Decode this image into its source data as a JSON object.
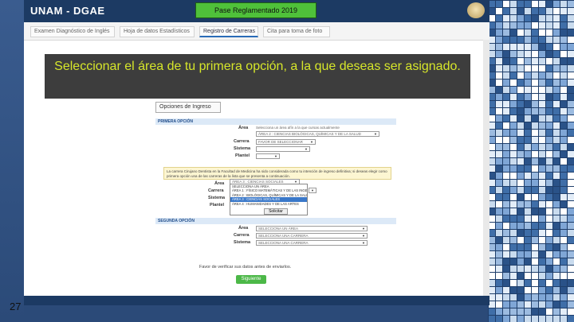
{
  "slide": {
    "title": "Seleccionar el área de tu primera opción, a la que deseas ser asignado.",
    "number": "27"
  },
  "app": {
    "title": "UNAM - DGAE",
    "badge": "Pase Reglamentado 2019",
    "tabs": [
      {
        "label": "Examen Diagnóstico de Inglés"
      },
      {
        "label": "Hoja de datos Estadísticos"
      },
      {
        "label": "Registro de Carreras"
      },
      {
        "label": "Cita para toma de foto"
      }
    ]
  },
  "form": {
    "heading": "Opciones de Ingreso",
    "first_section": "PRIMERA OPCIÓN",
    "second_section": "SEGUNDA OPCIÓN",
    "labels": {
      "area": "Área",
      "carrera": "Carrera",
      "sistema": "Sistema",
      "plantel": "Plantel"
    },
    "first": {
      "area_note": "Selecciona un área afín a la que cursas actualmente",
      "area_value": "ÁREA 2 : CIENCIAS BIOLÓGICAS, QUÍMICAS Y DE LA SALUD",
      "carrera_value": "FAVOR DE SELECCIONAR",
      "sistema_value": "",
      "plantel_value": "",
      "area2_value": "ÁREA 3 : CIENCIAS SOCIALES"
    },
    "note": "La carrera Cirujano Dentista en la Facultad de Medicina ha sido considerada como tu intención de ingreso definitiva; si deseas elegir como primera opción una de las carreras de la lista que se presenta a continuación.",
    "dropdown_options": [
      "SELECCIONA UN ÁREA",
      "ÁREA 1 : FÍSICO MATEMÁTICAS Y DE LAS INGENIERÍAS",
      "ÁREA 2 : BIOLÓGICAS, QUÍMICAS Y DE LA SALUD",
      "ÁREA 3 : CIENCIAS SOCIALES",
      "ÁREA 4 : HUMANIDADES Y DE LAS ARTES"
    ],
    "selected_option_index": 3,
    "solicitar_label": "Solicitar",
    "second": {
      "area_value": "SELECCIONA UN ÁREA",
      "carrera_value": "SELECCIONA UNA CARRERA",
      "sistema_value": "SELECCIONA UNA CARRERA"
    },
    "verify_text": "Favor de verificar sus datos antes de enviarlos.",
    "submit_label": "Siguiente"
  },
  "colors": {
    "accent": "#1c3a63",
    "banner_bg": "#3d3d3d",
    "banner_text": "#d6e62a",
    "badge": "#4fc13a",
    "submit": "#4cb848"
  }
}
